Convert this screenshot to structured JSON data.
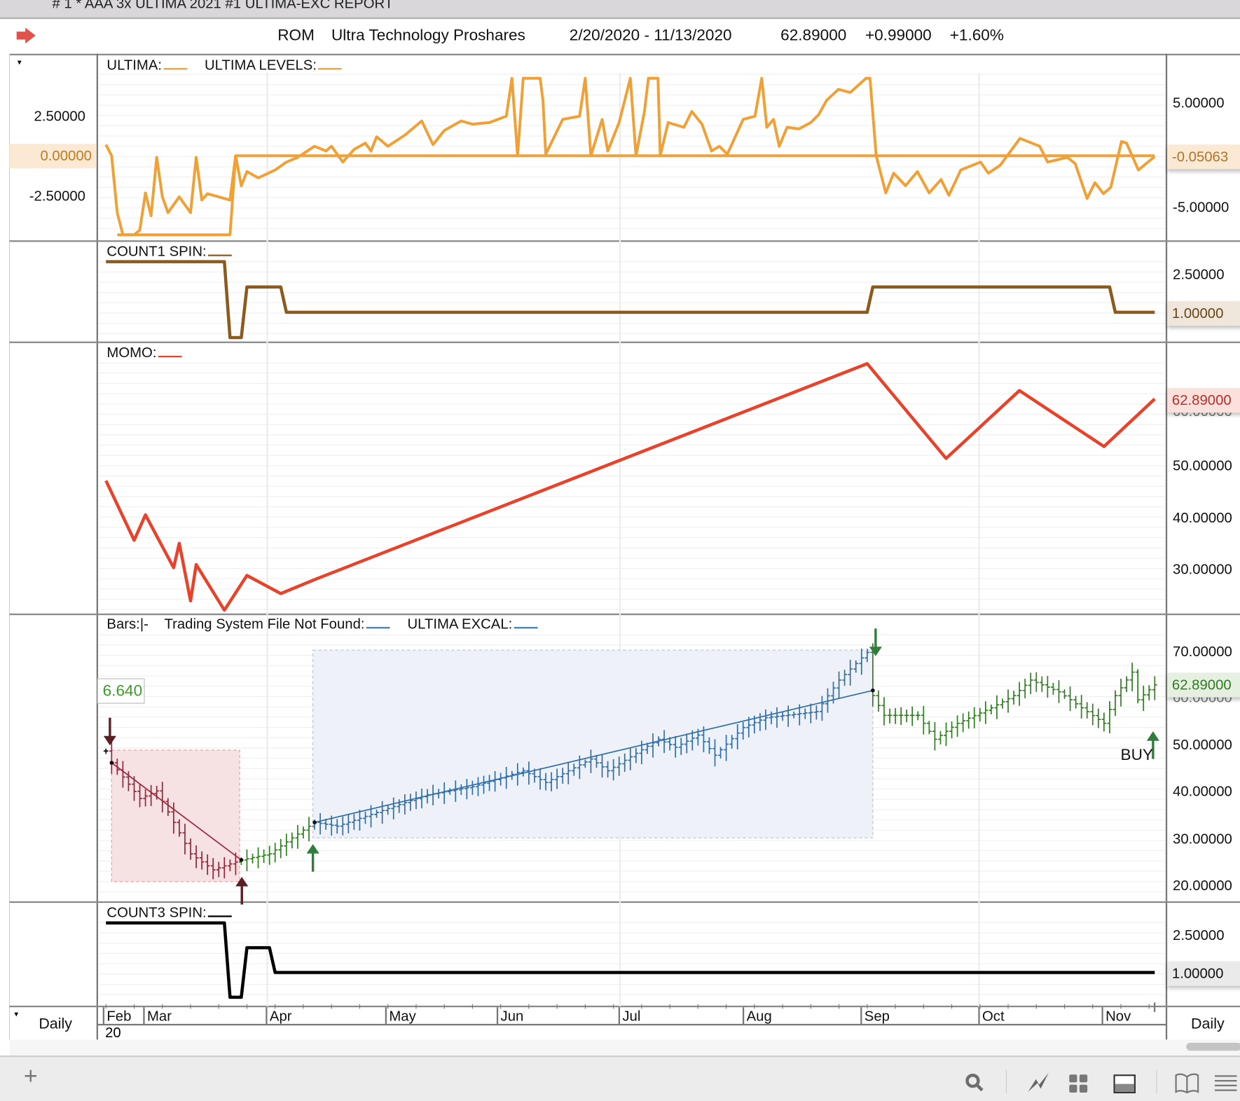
{
  "window": {
    "title": "#  1 * AAA 3x ULTIMA 2021 #1 ULTIMA-EXC REPORT"
  },
  "header": {
    "symbol": "ROM",
    "name": "Ultra Technology Proshares",
    "date_range": "2/20/2020 - 11/13/2020",
    "last": "62.89000",
    "change": "+0.99000",
    "change_pct": "+1.60%"
  },
  "panels": {
    "ultima": {
      "title": "ULTIMA:",
      "title2": "ULTIMA LEVELS:",
      "left_ticks": [
        "2.50000",
        "0.00000",
        "-2.50000"
      ],
      "right_ticks": [
        "5.00000",
        "-5.00000"
      ],
      "badge": "-0.05063",
      "color": "#f0a035"
    },
    "count1": {
      "title": "COUNT1 SPIN:",
      "right_ticks": [
        "2.50000"
      ],
      "badge": "1.00000",
      "color": "#8b5a1c"
    },
    "momo": {
      "title": "MOMO:",
      "right_ticks": [
        "50.00000",
        "40.00000",
        "30.00000"
      ],
      "badge": "62.89000",
      "color": "#e8432a"
    },
    "bars": {
      "title": "Bars:",
      "title_mark": "|-",
      "title2": "Trading System File Not Found:",
      "title3": "ULTIMA EXCAL:",
      "right_ticks": [
        "70.00000",
        "50.00000",
        "40.00000",
        "30.00000",
        "20.00000"
      ],
      "badge": "62.89000",
      "left_value": "6.640",
      "signal_label": "BUY"
    },
    "count3": {
      "title": "COUNT3 SPIN:",
      "right_ticks": [
        "2.50000"
      ],
      "badge": "1.00000",
      "color": "#000000"
    }
  },
  "time_axis": {
    "months": [
      "Feb",
      "Mar",
      "Apr",
      "May",
      "Jun",
      "Jul",
      "Aug",
      "Sep",
      "Oct",
      "Nov"
    ],
    "first_day": "20",
    "interval_left": "Daily",
    "interval_right": "Daily"
  },
  "toolbar": {
    "icons": [
      "add-icon",
      "search-icon",
      "chart-line-icon",
      "grid-icon",
      "panel-layout-icon",
      "book-icon",
      "menu-icon"
    ]
  },
  "chart_data": [
    {
      "type": "line",
      "title": "ULTIMA",
      "x_unit": "trading day index from 2/20/2020",
      "ylim": [
        -5.3,
        5.3
      ],
      "series": [
        {
          "name": "ULTIMA",
          "points": [
            [
              0,
              0.7
            ],
            [
              1,
              0
            ],
            [
              2,
              -3.6
            ],
            [
              3,
              -5
            ],
            [
              5,
              -5
            ],
            [
              6,
              -4.7
            ],
            [
              7,
              -2.35
            ],
            [
              8,
              -3.8
            ],
            [
              9,
              -0.1
            ],
            [
              10,
              -2.6
            ],
            [
              11,
              -3.6
            ],
            [
              13,
              -2.6
            ],
            [
              15,
              -3.6
            ],
            [
              16,
              -0.1
            ],
            [
              17,
              -2.8
            ],
            [
              18,
              -2.4
            ],
            [
              20,
              -2.6
            ],
            [
              22,
              -2.8
            ],
            [
              23,
              0
            ],
            [
              24,
              -1.9
            ],
            [
              25,
              -1
            ],
            [
              27,
              -1.4
            ],
            [
              30,
              -0.9
            ],
            [
              32,
              -0.4
            ],
            [
              34,
              -0.1
            ],
            [
              37,
              0.6
            ],
            [
              39,
              0.3
            ],
            [
              40,
              0.6
            ],
            [
              42,
              -0.4
            ],
            [
              44,
              0.4
            ],
            [
              46,
              0.8
            ],
            [
              47,
              0.3
            ],
            [
              48,
              1.2
            ],
            [
              50,
              0.6
            ],
            [
              53,
              1.3
            ],
            [
              56,
              2.2
            ],
            [
              58,
              0.7
            ],
            [
              60,
              1.6
            ],
            [
              63,
              2.2
            ],
            [
              65,
              2
            ],
            [
              68,
              2.1
            ],
            [
              71,
              2.5
            ],
            [
              72,
              4.9
            ],
            [
              73,
              0
            ],
            [
              74,
              4.9
            ],
            [
              77,
              4.9
            ],
            [
              77.5,
              3.5
            ],
            [
              78,
              0.1
            ],
            [
              81,
              2.3
            ],
            [
              84,
              2.5
            ],
            [
              85,
              4.9
            ],
            [
              86,
              0
            ],
            [
              88,
              2.3
            ],
            [
              89,
              0.3
            ],
            [
              91,
              2.1
            ],
            [
              93,
              4.9
            ],
            [
              94,
              0
            ],
            [
              95.5,
              2.8
            ],
            [
              96.2,
              4.9
            ],
            [
              97.9,
              4.9
            ],
            [
              98.3,
              0
            ],
            [
              99.7,
              2.1
            ],
            [
              102.5,
              1.8
            ],
            [
              103.9,
              2.8
            ],
            [
              105.7,
              2
            ],
            [
              107.4,
              0.3
            ],
            [
              108.8,
              0.6
            ],
            [
              110.2,
              0.1
            ],
            [
              113,
              2.3
            ],
            [
              115.1,
              2.5
            ],
            [
              116.3,
              4.9
            ],
            [
              117.2,
              1.8
            ],
            [
              118.4,
              2.3
            ],
            [
              119.4,
              0.6
            ],
            [
              120.8,
              1.8
            ],
            [
              122.9,
              1.7
            ],
            [
              125,
              2.1
            ],
            [
              126.4,
              2.6
            ],
            [
              127.8,
              3.5
            ],
            [
              129.9,
              4.2
            ],
            [
              132,
              4
            ],
            [
              134.8,
              4.9
            ],
            [
              135.5,
              4.9
            ],
            [
              136.6,
              0
            ],
            [
              138.3,
              -2.35
            ],
            [
              139.7,
              -1.1
            ],
            [
              141.8,
              -1.9
            ],
            [
              143.9,
              -1
            ],
            [
              146,
              -2.35
            ],
            [
              148.1,
              -1.5
            ],
            [
              149.5,
              -2.5
            ],
            [
              151.6,
              -0.9
            ],
            [
              155.1,
              -0.4
            ],
            [
              156.5,
              -1.1
            ],
            [
              158.6,
              -0.6
            ],
            [
              162.1,
              1.1
            ],
            [
              165.6,
              0.6
            ],
            [
              167,
              -0.4
            ],
            [
              170.5,
              -0.1
            ],
            [
              171.9,
              -0.5
            ],
            [
              174,
              -2.7
            ],
            [
              175.4,
              -1.7
            ],
            [
              176.9,
              -2.4
            ],
            [
              178.2,
              -2
            ],
            [
              180.1,
              0.9
            ],
            [
              181,
              0.8
            ],
            [
              183.1,
              -0.9
            ],
            [
              186,
              -0.05
            ]
          ]
        },
        {
          "name": "ULTIMA LEVELS",
          "points": [
            [
              2,
              -5
            ],
            [
              22,
              -5
            ],
            [
              23,
              0
            ],
            [
              186,
              0
            ]
          ]
        }
      ]
    },
    {
      "type": "line",
      "title": "COUNT1 SPIN",
      "ylim": [
        0,
        3
      ],
      "series": [
        {
          "name": "COUNT1 SPIN",
          "points": [
            [
              0,
              3
            ],
            [
              21,
              3
            ],
            [
              22,
              0
            ],
            [
              24,
              0
            ],
            [
              25,
              2
            ],
            [
              31,
              2
            ],
            [
              32,
              1
            ],
            [
              135,
              1
            ],
            [
              136,
              2
            ],
            [
              178,
              2
            ],
            [
              179,
              1
            ],
            [
              186,
              1
            ]
          ]
        }
      ]
    },
    {
      "type": "line",
      "title": "MOMO",
      "ylim": [
        22,
        72
      ],
      "series": [
        {
          "name": "MOMO",
          "points": [
            [
              0,
              47.1
            ],
            [
              5,
              35.6
            ],
            [
              7,
              40.5
            ],
            [
              12,
              30.3
            ],
            [
              13,
              35
            ],
            [
              15,
              23.9
            ],
            [
              16,
              30.9
            ],
            [
              21,
              22.1
            ],
            [
              25,
              28.8
            ],
            [
              31,
              25.3
            ],
            [
              37,
              28
            ],
            [
              135,
              69.7
            ],
            [
              149,
              51.4
            ],
            [
              162,
              64.5
            ],
            [
              177,
              53.7
            ],
            [
              186,
              62.89
            ]
          ]
        }
      ]
    },
    {
      "type": "bar-ohlc",
      "title": "ROM Daily Bars",
      "ylim": [
        18,
        74
      ],
      "close_path": [
        [
          0,
          48.8
        ],
        [
          1,
          46.3
        ],
        [
          6,
          38.7
        ],
        [
          9,
          40.3
        ],
        [
          12,
          33.6
        ],
        [
          15,
          26.9
        ],
        [
          19,
          23.5
        ],
        [
          24,
          25.6
        ],
        [
          29,
          26.9
        ],
        [
          33,
          30.3
        ],
        [
          37,
          33.6
        ],
        [
          41,
          32.8
        ],
        [
          47,
          35.3
        ],
        [
          57,
          39.5
        ],
        [
          65,
          41.2
        ],
        [
          74,
          44.6
        ],
        [
          78,
          42.1
        ],
        [
          86,
          47.1
        ],
        [
          89,
          44.6
        ],
        [
          98,
          51.3
        ],
        [
          101,
          49.6
        ],
        [
          105,
          52.2
        ],
        [
          108,
          47.9
        ],
        [
          113,
          53.8
        ],
        [
          117,
          55.9
        ],
        [
          126,
          57.2
        ],
        [
          130,
          63.9
        ],
        [
          135,
          69.8
        ],
        [
          136,
          60.6
        ],
        [
          138,
          56.4
        ],
        [
          144,
          56.4
        ],
        [
          147,
          51.3
        ],
        [
          151,
          54.7
        ],
        [
          157,
          58
        ],
        [
          161,
          60.6
        ],
        [
          164,
          63.9
        ],
        [
          169,
          61.4
        ],
        [
          173,
          58
        ],
        [
          177,
          54.7
        ],
        [
          179,
          60.6
        ],
        [
          182,
          65.6
        ],
        [
          183,
          59.7
        ],
        [
          186,
          62.89
        ]
      ],
      "segments": [
        {
          "name": "downtrend",
          "from": 1,
          "to": 24,
          "color": "#9b2335"
        },
        {
          "name": "neutral",
          "from": 24,
          "to": 37,
          "color": "#2e7d1e"
        },
        {
          "name": "uptrend",
          "from": 37,
          "to": 136,
          "color": "#2f6ea8"
        },
        {
          "name": "neutral",
          "from": 136,
          "to": 186,
          "color": "#2e7d1e"
        }
      ],
      "trendlines": [
        {
          "name": "down-trendline",
          "from": [
            1,
            46.3
          ],
          "to": [
            24,
            25.6
          ],
          "color": "#9b2335"
        },
        {
          "name": "up-trendline",
          "from": [
            37,
            33.6
          ],
          "to": [
            136,
            61.7
          ],
          "color": "#2f6ea8"
        }
      ],
      "zones": [
        {
          "name": "down-zone",
          "x": [
            1,
            23.7
          ],
          "y": [
            21,
            49
          ],
          "color": "#f6e1e3"
        },
        {
          "name": "up-zone",
          "x": [
            36.7,
            136
          ],
          "y": [
            30.3,
            70.3
          ],
          "color": "#eef1f7"
        }
      ],
      "signals": [
        {
          "type": "down",
          "x": 0.7,
          "price": 50,
          "color": "#5a1e24"
        },
        {
          "type": "up",
          "x": 24.1,
          "price": 22,
          "color": "#5a1e24"
        },
        {
          "type": "up",
          "x": 36.7,
          "price": 29,
          "color": "#2e7d3a"
        },
        {
          "type": "down",
          "x": 136.5,
          "price": 69,
          "color": "#2e7d3a"
        },
        {
          "type": "up",
          "x": 185.7,
          "price": 53,
          "color": "#2e7d3a"
        }
      ]
    },
    {
      "type": "line",
      "title": "COUNT3 SPIN",
      "ylim": [
        0,
        3
      ],
      "series": [
        {
          "name": "COUNT3 SPIN",
          "points": [
            [
              0,
              3
            ],
            [
              21,
              3
            ],
            [
              22,
              0
            ],
            [
              24,
              0
            ],
            [
              25,
              2
            ],
            [
              29,
              2
            ],
            [
              30,
              1
            ],
            [
              186,
              1
            ]
          ]
        }
      ]
    }
  ]
}
